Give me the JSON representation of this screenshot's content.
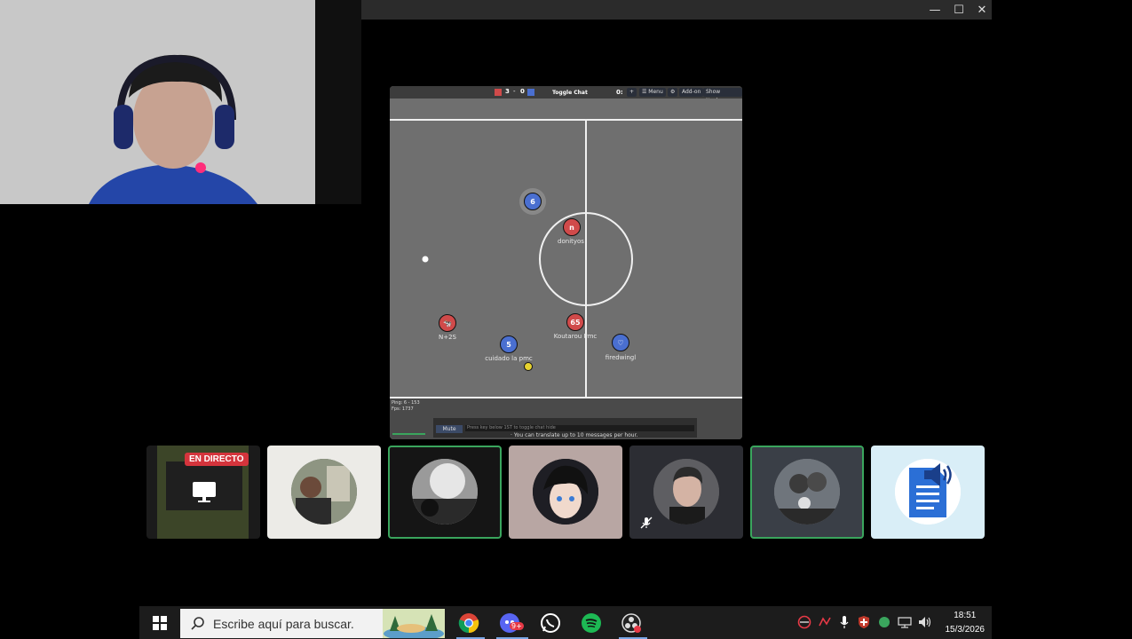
{
  "window": {
    "controls": {
      "minimize": "—",
      "maximize": "☐",
      "close": "✕"
    }
  },
  "game": {
    "score": {
      "red": "3",
      "separator": "-",
      "blue": "0"
    },
    "toggle_chat": "Toggle Chat",
    "time": "0:",
    "buttons": {
      "menu": "☰ Menu",
      "addon": "Add-on",
      "show_navbar": "Show Navbar"
    },
    "players": [
      {
        "team": "blue",
        "avatar": "6",
        "name": ""
      },
      {
        "team": "red",
        "avatar": "n",
        "name": "donityos"
      },
      {
        "team": "red",
        "avatar": "🐄",
        "name": "N+2S"
      },
      {
        "team": "red",
        "avatar": "65",
        "name": "Koutarou Pmc"
      },
      {
        "team": "blue",
        "avatar": "5",
        "name": "cuidado la pmc"
      },
      {
        "team": "blue",
        "avatar": "♡",
        "name": "firedwingl"
      }
    ],
    "stats": {
      "ping": "Ping: 6 - 153",
      "fps": "Fps: 1737"
    },
    "chat": {
      "mute_label": "Mute",
      "placeholder": "Press key below 1ST to toggle chat hide",
      "translate_notice": "· You can translate up to 10 messages per hour."
    }
  },
  "participants": {
    "live_badge": "EN DIRECTO"
  },
  "taskbar": {
    "search_placeholder": "Escribe aquí para buscar.",
    "discord_badge": "9+",
    "time": "18:51",
    "date": "15/3/2026"
  },
  "colors": {
    "red_team": "#d04a4a",
    "blue_team": "#4a6fd0",
    "live_red": "#d4343c",
    "active_border": "#3aa55d",
    "taskbar_accent": "#7aa7e6"
  }
}
